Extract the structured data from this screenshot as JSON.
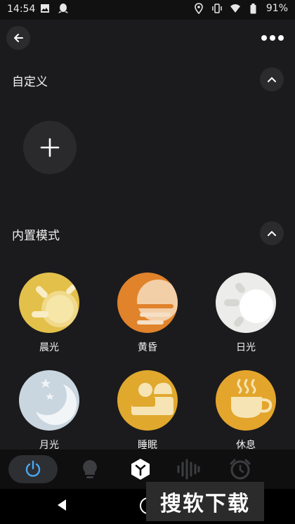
{
  "status_bar": {
    "time": "14:54",
    "battery": "91%",
    "left_icons": [
      "image-icon",
      "qq-icon"
    ],
    "right_icons": [
      "location-icon",
      "vibrate-icon",
      "wifi-icon",
      "battery-icon"
    ]
  },
  "header": {
    "back_icon": "back-arrow-icon",
    "more_icon": "more-dots-icon"
  },
  "sections": {
    "custom": {
      "title": "自定义",
      "add_icon": "plus-icon",
      "collapse_icon": "chevron-up-icon"
    },
    "builtin": {
      "title": "内置模式",
      "collapse_icon": "chevron-up-icon"
    }
  },
  "modes": [
    {
      "label": "晨光",
      "icon": "morning-sun-icon",
      "color": "#e3c04a"
    },
    {
      "label": "黄昏",
      "icon": "dusk-icon",
      "color": "#e0832b"
    },
    {
      "label": "日光",
      "icon": "daylight-icon",
      "color": "#ececea"
    },
    {
      "label": "月光",
      "icon": "moonlight-icon",
      "color": "#c9d6e0"
    },
    {
      "label": "睡眠",
      "icon": "sleep-bed-icon",
      "color": "#e0a82d"
    },
    {
      "label": "休息",
      "icon": "rest-cup-icon",
      "color": "#e3a52c"
    }
  ],
  "bottom_nav": [
    {
      "icon": "power-icon",
      "active": true
    },
    {
      "icon": "bulb-icon",
      "active": false
    },
    {
      "icon": "scene-hexagon-icon",
      "active": false
    },
    {
      "icon": "music-bars-icon",
      "active": false
    },
    {
      "icon": "alarm-clock-icon",
      "active": false
    }
  ],
  "watermark": {
    "text": "搜软下载"
  },
  "colors": {
    "background": "#1b1b1d",
    "accent": "#4aa8f0"
  }
}
